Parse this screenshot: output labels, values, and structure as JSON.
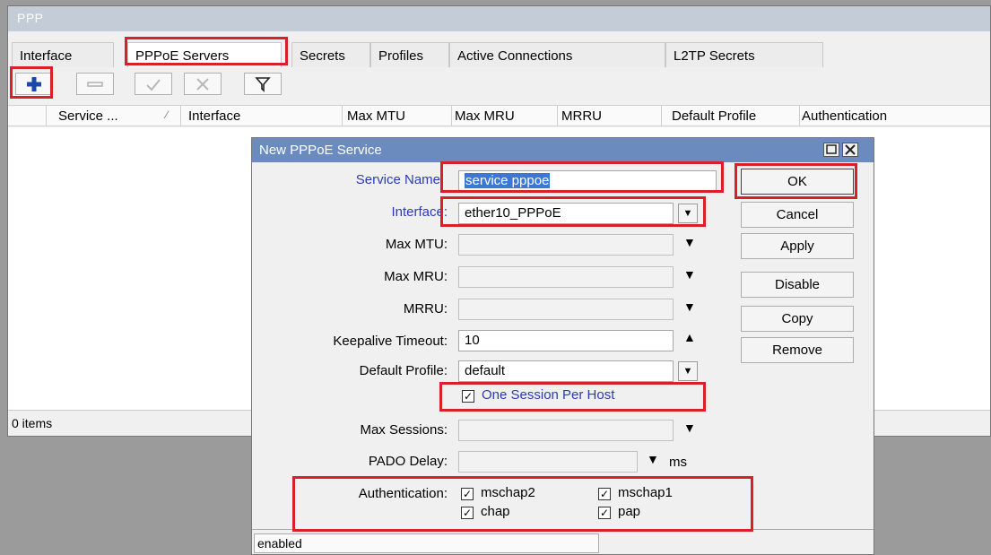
{
  "ppp_window": {
    "title": "PPP",
    "tabs": [
      {
        "label": "Interface"
      },
      {
        "label": "PPPoE Servers"
      },
      {
        "label": "Secrets"
      },
      {
        "label": "Profiles"
      },
      {
        "label": "Active Connections"
      },
      {
        "label": "L2TP Secrets"
      }
    ],
    "active_tab": "PPPoE Servers",
    "toolbar": {
      "add_icon": "plus-icon",
      "remove_icon": "minus-icon",
      "enable_icon": "check-icon",
      "disable_icon": "cross-icon",
      "filter_icon": "filter-icon"
    },
    "columns": [
      {
        "label": "Service ..."
      },
      {
        "label": "Interface"
      },
      {
        "label": "Max MTU"
      },
      {
        "label": "Max MRU"
      },
      {
        "label": "MRRU"
      },
      {
        "label": "Default Profile"
      },
      {
        "label": "Authentication"
      }
    ],
    "status": "0 items"
  },
  "dialog": {
    "title": "New PPPoE Service",
    "fields": {
      "service_name": {
        "label": "Service Name",
        "value": "service pppoe"
      },
      "interface": {
        "label": "Interface:",
        "value": "ether10_PPPoE"
      },
      "max_mtu": {
        "label": "Max MTU:",
        "value": ""
      },
      "max_mru": {
        "label": "Max MRU:",
        "value": ""
      },
      "mrru": {
        "label": "MRRU:",
        "value": ""
      },
      "keepalive_timeout": {
        "label": "Keepalive Timeout:",
        "value": "10"
      },
      "default_profile": {
        "label": "Default Profile:",
        "value": "default"
      },
      "one_session_per_host": {
        "label": "One Session Per Host",
        "checked": true
      },
      "max_sessions": {
        "label": "Max Sessions:",
        "value": ""
      },
      "pado_delay": {
        "label": "PADO Delay:",
        "value": "",
        "unit": "ms"
      }
    },
    "authentication": {
      "label": "Authentication:",
      "options": [
        {
          "label": "mschap2",
          "checked": true
        },
        {
          "label": "mschap1",
          "checked": true
        },
        {
          "label": "chap",
          "checked": true
        },
        {
          "label": "pap",
          "checked": true
        }
      ]
    },
    "buttons": {
      "ok": "OK",
      "cancel": "Cancel",
      "apply": "Apply",
      "disable": "Disable",
      "copy": "Copy",
      "remove": "Remove"
    },
    "status": "enabled"
  },
  "colors": {
    "highlight_red": "#d92027",
    "dialog_title_bg": "#6b8bbf",
    "link_blue": "#2b3bb5",
    "selection_blue": "#3a78d8"
  }
}
